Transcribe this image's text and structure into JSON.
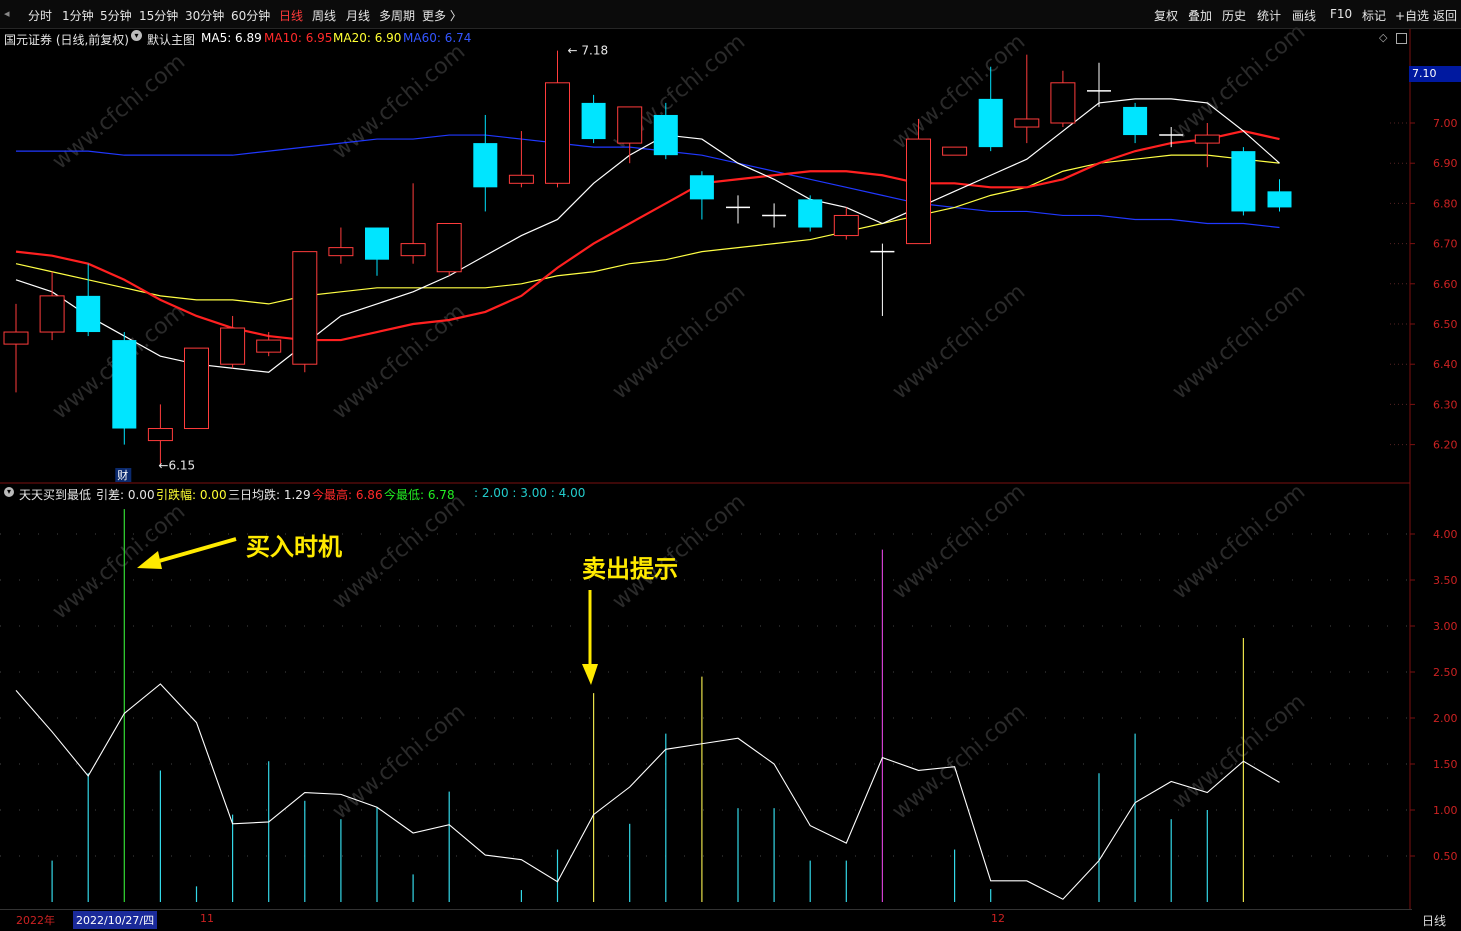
{
  "toolbar": {
    "periods": [
      "分时",
      "1分钟",
      "5分钟",
      "15分钟",
      "30分钟",
      "60分钟",
      "日线",
      "周线",
      "月线",
      "多周期",
      "更多 〉"
    ],
    "active_period": "日线",
    "right_items": [
      "复权",
      "叠加",
      "历史",
      "统计",
      "画线",
      "F10",
      "标记",
      "+自选",
      "返回"
    ]
  },
  "main_panel": {
    "stock": "国元证券 (日线,前复权)",
    "template": "默认主图",
    "ma": [
      {
        "label": "MA5: 6.89",
        "color": "#ffffff"
      },
      {
        "label": "MA10: 6.95",
        "color": "#ff2a2a"
      },
      {
        "label": "MA20: 6.90",
        "color": "#ffff33"
      },
      {
        "label": "MA60: 6.74",
        "color": "#3355ff"
      }
    ],
    "high_mark": "7.18",
    "low_mark": "6.15",
    "price_tag": "7.10",
    "cai_label": "财"
  },
  "sub_panel": {
    "name": "天天买到最低",
    "items": [
      {
        "label": "引差: 0.00",
        "color": "#e6e6e6"
      },
      {
        "label": "引跌幅: 0.00",
        "color": "#ffff33"
      },
      {
        "label": "三日均跌: 1.29",
        "color": "#e6e6e6"
      },
      {
        "label": "今最高: 6.86",
        "color": "#ff2a2a"
      },
      {
        "label": "今最低: 6.78",
        "color": "#22ee22"
      },
      {
        "label": ": 2.00 : 3.00 : 4.00",
        "color": "#22cccc"
      }
    ]
  },
  "annotations": {
    "buy": "买入时机",
    "sell": "卖出提示"
  },
  "date_bar": {
    "year": "2022年",
    "selected": "2022/10/27/四",
    "m11": "11",
    "m12": "12",
    "period": "日线"
  },
  "colors": {
    "up": "#ff3c3c",
    "down": "#00e5ff",
    "ma5": "#ffffff",
    "ma10": "#ff2020",
    "ma20": "#ffff44",
    "ma60": "#2038ff"
  },
  "chart_data": {
    "type": "candlestick",
    "price_axis": {
      "ticks": [
        "7.00",
        "6.90",
        "6.80",
        "6.70",
        "6.60",
        "6.50",
        "6.40",
        "6.30",
        "6.20"
      ],
      "range": [
        6.1,
        7.25
      ]
    },
    "candles": [
      {
        "o": 6.45,
        "c": 6.48,
        "h": 6.55,
        "l": 6.33
      },
      {
        "o": 6.48,
        "c": 6.57,
        "h": 6.63,
        "l": 6.46
      },
      {
        "o": 6.57,
        "c": 6.48,
        "h": 6.65,
        "l": 6.47
      },
      {
        "o": 6.46,
        "c": 6.24,
        "h": 6.48,
        "l": 6.2
      },
      {
        "o": 6.21,
        "c": 6.24,
        "h": 6.3,
        "l": 6.15
      },
      {
        "o": 6.24,
        "c": 6.44,
        "h": 6.44,
        "l": 6.24
      },
      {
        "o": 6.4,
        "c": 6.49,
        "h": 6.52,
        "l": 6.39
      },
      {
        "o": 6.43,
        "c": 6.46,
        "h": 6.48,
        "l": 6.42
      },
      {
        "o": 6.4,
        "c": 6.68,
        "h": 6.68,
        "l": 6.38
      },
      {
        "o": 6.67,
        "c": 6.69,
        "h": 6.74,
        "l": 6.65
      },
      {
        "o": 6.74,
        "c": 6.66,
        "h": 6.74,
        "l": 6.62
      },
      {
        "o": 6.67,
        "c": 6.7,
        "h": 6.85,
        "l": 6.65
      },
      {
        "o": 6.63,
        "c": 6.75,
        "h": 6.75,
        "l": 6.62
      },
      {
        "o": 6.95,
        "c": 6.84,
        "h": 7.02,
        "l": 6.78
      },
      {
        "o": 6.85,
        "c": 6.87,
        "h": 6.98,
        "l": 6.84
      },
      {
        "o": 6.85,
        "c": 7.1,
        "h": 7.18,
        "l": 6.84
      },
      {
        "o": 7.05,
        "c": 6.96,
        "h": 7.07,
        "l": 6.95
      },
      {
        "o": 6.95,
        "c": 7.04,
        "h": 7.04,
        "l": 6.9
      },
      {
        "o": 7.02,
        "c": 6.92,
        "h": 7.05,
        "l": 6.91
      },
      {
        "o": 6.87,
        "c": 6.81,
        "h": 6.88,
        "l": 6.76
      },
      {
        "o": 6.79,
        "c": 6.79,
        "h": 6.82,
        "l": 6.75
      },
      {
        "o": 6.77,
        "c": 6.77,
        "h": 6.8,
        "l": 6.74
      },
      {
        "o": 6.81,
        "c": 6.74,
        "h": 6.82,
        "l": 6.73
      },
      {
        "o": 6.72,
        "c": 6.77,
        "h": 6.79,
        "l": 6.71
      },
      {
        "o": 6.68,
        "c": 6.68,
        "h": 6.7,
        "l": 6.52
      },
      {
        "o": 6.7,
        "c": 6.96,
        "h": 7.01,
        "l": 6.7
      },
      {
        "o": 6.92,
        "c": 6.94,
        "h": 6.94,
        "l": 6.92
      },
      {
        "o": 7.06,
        "c": 6.94,
        "h": 7.14,
        "l": 6.93
      },
      {
        "o": 6.99,
        "c": 7.01,
        "h": 7.17,
        "l": 6.95
      },
      {
        "o": 7.0,
        "c": 7.1,
        "h": 7.13,
        "l": 6.99
      },
      {
        "o": 7.08,
        "c": 7.08,
        "h": 7.15,
        "l": 7.04
      },
      {
        "o": 7.04,
        "c": 6.97,
        "h": 7.05,
        "l": 6.95
      },
      {
        "o": 6.97,
        "c": 6.97,
        "h": 6.99,
        "l": 6.94
      },
      {
        "o": 6.95,
        "c": 6.97,
        "h": 7.0,
        "l": 6.89
      },
      {
        "o": 6.93,
        "c": 6.78,
        "h": 6.94,
        "l": 6.77
      },
      {
        "o": 6.83,
        "c": 6.79,
        "h": 6.86,
        "l": 6.78
      }
    ],
    "ma5": [
      6.61,
      6.58,
      6.52,
      6.47,
      6.42,
      6.4,
      6.39,
      6.38,
      6.45,
      6.52,
      6.55,
      6.58,
      6.62,
      6.67,
      6.72,
      6.76,
      6.85,
      6.92,
      6.97,
      6.96,
      6.9,
      6.86,
      6.81,
      6.79,
      6.75,
      6.79,
      6.83,
      6.87,
      6.91,
      6.98,
      7.05,
      7.06,
      7.06,
      7.05,
      6.98,
      6.9
    ],
    "ma10": [
      6.68,
      6.67,
      6.65,
      6.61,
      6.56,
      6.52,
      6.49,
      6.47,
      6.46,
      6.46,
      6.48,
      6.5,
      6.51,
      6.53,
      6.57,
      6.64,
      6.7,
      6.75,
      6.8,
      6.85,
      6.86,
      6.87,
      6.88,
      6.88,
      6.87,
      6.85,
      6.85,
      6.84,
      6.84,
      6.86,
      6.9,
      6.93,
      6.95,
      6.96,
      6.98,
      6.96
    ],
    "ma20": [
      6.65,
      6.63,
      6.61,
      6.59,
      6.57,
      6.56,
      6.56,
      6.55,
      6.57,
      6.58,
      6.59,
      6.59,
      6.59,
      6.59,
      6.6,
      6.62,
      6.63,
      6.65,
      6.66,
      6.68,
      6.69,
      6.7,
      6.71,
      6.73,
      6.75,
      6.77,
      6.79,
      6.82,
      6.84,
      6.88,
      6.9,
      6.91,
      6.92,
      6.92,
      6.91,
      6.9
    ],
    "ma60": [
      6.93,
      6.93,
      6.93,
      6.92,
      6.92,
      6.92,
      6.92,
      6.93,
      6.94,
      6.95,
      6.96,
      6.96,
      6.97,
      6.97,
      6.96,
      6.95,
      6.94,
      6.94,
      6.93,
      6.92,
      6.9,
      6.88,
      6.86,
      6.84,
      6.82,
      6.8,
      6.79,
      6.78,
      6.78,
      6.77,
      6.77,
      6.76,
      6.76,
      6.75,
      6.75,
      6.74
    ],
    "sub_axis": {
      "ticks": [
        "4.00",
        "3.50",
        "3.00",
        "2.50",
        "2.00",
        "1.50",
        "1.00",
        "0.50"
      ],
      "range": [
        0,
        4.4
      ]
    },
    "sub_line": [
      2.3,
      1.85,
      1.37,
      2.05,
      2.37,
      1.95,
      0.85,
      0.87,
      1.19,
      1.17,
      1.03,
      0.75,
      0.84,
      0.51,
      0.46,
      0.22,
      0.95,
      1.25,
      1.66,
      1.72,
      1.78,
      1.5,
      0.83,
      0.64,
      1.57,
      1.43,
      1.47,
      0.23,
      0.23,
      0.03,
      0.45,
      1.08,
      1.31,
      1.19,
      1.53,
      1.3
    ],
    "sub_bars": [
      {
        "i": 1,
        "v": 0.45,
        "c": "cyan"
      },
      {
        "i": 2,
        "v": 1.4,
        "c": "cyan"
      },
      {
        "i": 3,
        "v": 4.27,
        "c": "green"
      },
      {
        "i": 4,
        "v": 1.43,
        "c": "cyan"
      },
      {
        "i": 5,
        "v": 0.17,
        "c": "cyan"
      },
      {
        "i": 6,
        "v": 0.95,
        "c": "cyan"
      },
      {
        "i": 7,
        "v": 1.53,
        "c": "cyan"
      },
      {
        "i": 8,
        "v": 1.1,
        "c": "cyan"
      },
      {
        "i": 9,
        "v": 0.9,
        "c": "cyan"
      },
      {
        "i": 10,
        "v": 1.03,
        "c": "cyan"
      },
      {
        "i": 11,
        "v": 0.3,
        "c": "cyan"
      },
      {
        "i": 12,
        "v": 1.2,
        "c": "cyan"
      },
      {
        "i": 14,
        "v": 0.13,
        "c": "cyan"
      },
      {
        "i": 15,
        "v": 0.57,
        "c": "cyan"
      },
      {
        "i": 16,
        "v": 2.27,
        "c": "yellow"
      },
      {
        "i": 17,
        "v": 0.85,
        "c": "cyan"
      },
      {
        "i": 18,
        "v": 1.83,
        "c": "cyan"
      },
      {
        "i": 19,
        "v": 2.45,
        "c": "yellow"
      },
      {
        "i": 20,
        "v": 1.02,
        "c": "cyan"
      },
      {
        "i": 21,
        "v": 1.02,
        "c": "cyan"
      },
      {
        "i": 22,
        "v": 0.45,
        "c": "cyan"
      },
      {
        "i": 23,
        "v": 0.45,
        "c": "cyan"
      },
      {
        "i": 24,
        "v": 3.83,
        "c": "magenta"
      },
      {
        "i": 26,
        "v": 0.57,
        "c": "cyan"
      },
      {
        "i": 27,
        "v": 0.14,
        "c": "cyan"
      },
      {
        "i": 30,
        "v": 1.4,
        "c": "cyan"
      },
      {
        "i": 31,
        "v": 1.83,
        "c": "cyan"
      },
      {
        "i": 32,
        "v": 0.9,
        "c": "cyan"
      },
      {
        "i": 33,
        "v": 1.0,
        "c": "cyan"
      },
      {
        "i": 34,
        "v": 2.87,
        "c": "yellow"
      }
    ]
  }
}
